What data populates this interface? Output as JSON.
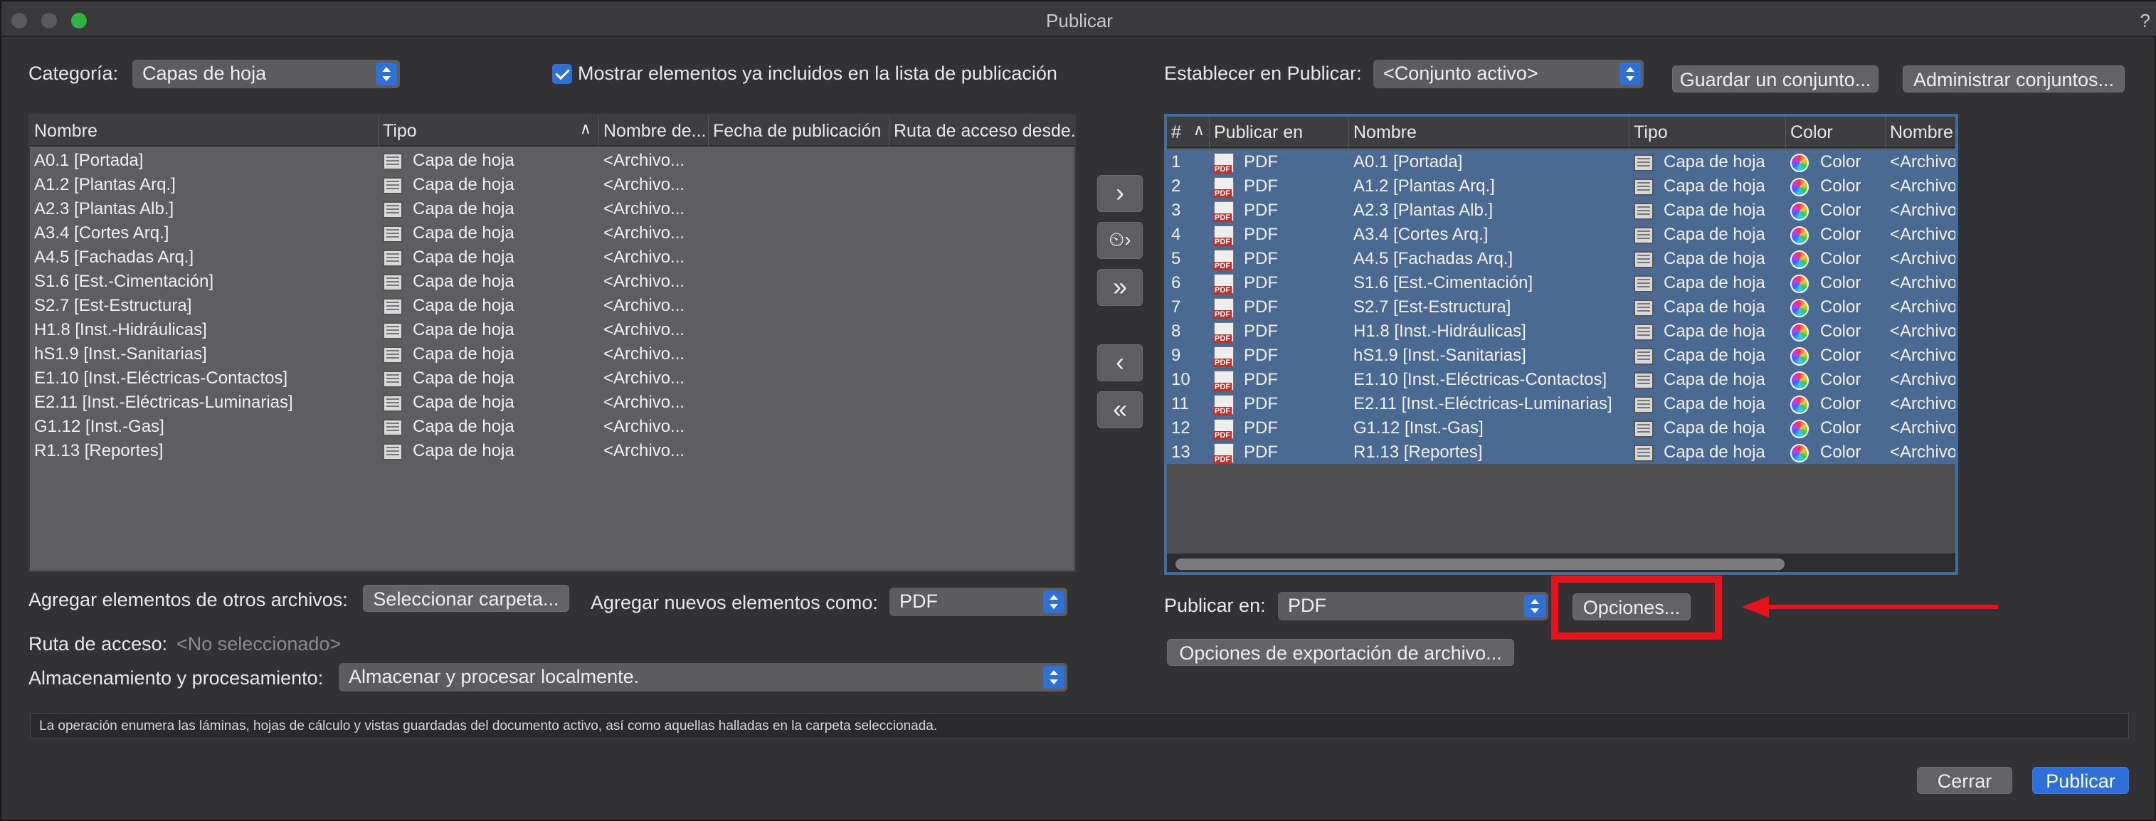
{
  "window": {
    "title": "Publicar",
    "help": "?"
  },
  "left": {
    "category_label": "Categoría:",
    "category_value": "Capas de hoja",
    "show_included_label": "Mostrar elementos ya incluidos en la lista de publicación",
    "columns": [
      "Nombre",
      "Tipo",
      "Nombre de...",
      "Fecha de publicación",
      "Ruta de acceso desde..."
    ],
    "rows": [
      {
        "name": "A0.1 [Portada]",
        "type": "Capa de hoja",
        "file": "<Archivo..."
      },
      {
        "name": "A1.2 [Plantas Arq.]",
        "type": "Capa de hoja",
        "file": "<Archivo..."
      },
      {
        "name": "A2.3 [Plantas Alb.]",
        "type": "Capa de hoja",
        "file": "<Archivo..."
      },
      {
        "name": "A3.4 [Cortes Arq.]",
        "type": "Capa de hoja",
        "file": "<Archivo..."
      },
      {
        "name": "A4.5 [Fachadas Arq.]",
        "type": "Capa de hoja",
        "file": "<Archivo..."
      },
      {
        "name": "S1.6 [Est.-Cimentación]",
        "type": "Capa de hoja",
        "file": "<Archivo..."
      },
      {
        "name": "S2.7 [Est-Estructura]",
        "type": "Capa de hoja",
        "file": "<Archivo..."
      },
      {
        "name": "H1.8 [Inst.-Hidráulicas]",
        "type": "Capa de hoja",
        "file": "<Archivo..."
      },
      {
        "name": "hS1.9 [Inst.-Sanitarias]",
        "type": "Capa de hoja",
        "file": "<Archivo..."
      },
      {
        "name": "E1.10 [Inst.-Eléctricas-Contactos]",
        "type": "Capa de hoja",
        "file": "<Archivo..."
      },
      {
        "name": "E2.11 [Inst.-Eléctricas-Luminarias]",
        "type": "Capa de hoja",
        "file": "<Archivo..."
      },
      {
        "name": "G1.12 [Inst.-Gas]",
        "type": "Capa de hoja",
        "file": "<Archivo..."
      },
      {
        "name": "R1.13 [Reportes]",
        "type": "Capa de hoja",
        "file": "<Archivo..."
      }
    ],
    "add_from_label": "Agregar elementos de otros archivos:",
    "select_folder": "Seleccionar carpeta...",
    "add_as_label": "Agregar nuevos elementos como:",
    "add_as_value": "PDF",
    "path_label": "Ruta de acceso:",
    "path_value": "<No seleccionado>",
    "storage_label": "Almacenamiento y procesamiento:",
    "storage_value": "Almacenar y procesar localmente."
  },
  "middle": {
    "add": "›",
    "add_time": "⏲›",
    "add_all": "»",
    "remove": "‹",
    "remove_all": "«"
  },
  "right": {
    "set_label": "Establecer en Publicar:",
    "set_value": "<Conjunto activo>",
    "save_set": "Guardar un conjunto...",
    "manage_sets": "Administrar conjuntos...",
    "columns": [
      "#",
      "Publicar en",
      "Nombre",
      "Tipo",
      "Color",
      "Nombre de"
    ],
    "rows": [
      {
        "n": "1",
        "to": "PDF",
        "name": "A0.1 [Portada]",
        "type": "Capa de hoja",
        "color": "Color",
        "file": "<Archivo"
      },
      {
        "n": "2",
        "to": "PDF",
        "name": "A1.2 [Plantas Arq.]",
        "type": "Capa de hoja",
        "color": "Color",
        "file": "<Archivo"
      },
      {
        "n": "3",
        "to": "PDF",
        "name": "A2.3 [Plantas Alb.]",
        "type": "Capa de hoja",
        "color": "Color",
        "file": "<Archivo"
      },
      {
        "n": "4",
        "to": "PDF",
        "name": "A3.4 [Cortes Arq.]",
        "type": "Capa de hoja",
        "color": "Color",
        "file": "<Archivo"
      },
      {
        "n": "5",
        "to": "PDF",
        "name": "A4.5 [Fachadas Arq.]",
        "type": "Capa de hoja",
        "color": "Color",
        "file": "<Archivo"
      },
      {
        "n": "6",
        "to": "PDF",
        "name": "S1.6 [Est.-Cimentación]",
        "type": "Capa de hoja",
        "color": "Color",
        "file": "<Archivo"
      },
      {
        "n": "7",
        "to": "PDF",
        "name": "S2.7 [Est-Estructura]",
        "type": "Capa de hoja",
        "color": "Color",
        "file": "<Archivo"
      },
      {
        "n": "8",
        "to": "PDF",
        "name": "H1.8 [Inst.-Hidráulicas]",
        "type": "Capa de hoja",
        "color": "Color",
        "file": "<Archivo"
      },
      {
        "n": "9",
        "to": "PDF",
        "name": "hS1.9 [Inst.-Sanitarias]",
        "type": "Capa de hoja",
        "color": "Color",
        "file": "<Archivo"
      },
      {
        "n": "10",
        "to": "PDF",
        "name": "E1.10 [Inst.-Eléctricas-Contactos]",
        "type": "Capa de hoja",
        "color": "Color",
        "file": "<Archivo"
      },
      {
        "n": "11",
        "to": "PDF",
        "name": "E2.11 [Inst.-Eléctricas-Luminarias]",
        "type": "Capa de hoja",
        "color": "Color",
        "file": "<Archivo"
      },
      {
        "n": "12",
        "to": "PDF",
        "name": "G1.12 [Inst.-Gas]",
        "type": "Capa de hoja",
        "color": "Color",
        "file": "<Archivo"
      },
      {
        "n": "13",
        "to": "PDF",
        "name": "R1.13 [Reportes]",
        "type": "Capa de hoja",
        "color": "Color",
        "file": "<Archivo"
      }
    ],
    "publish_to_label": "Publicar en:",
    "publish_to_value": "PDF",
    "options": "Opciones...",
    "export_options": "Opciones de exportación de archivo..."
  },
  "status": "La operación enumera las láminas, hojas de cálculo y vistas guardadas del documento activo, así como aquellas halladas en la carpeta seleccionada.",
  "footer": {
    "close": "Cerrar",
    "publish": "Publicar"
  },
  "colors": {
    "accent": "#2f6fd8",
    "highlight": "#e8121a",
    "selection": "#4a6a92"
  }
}
